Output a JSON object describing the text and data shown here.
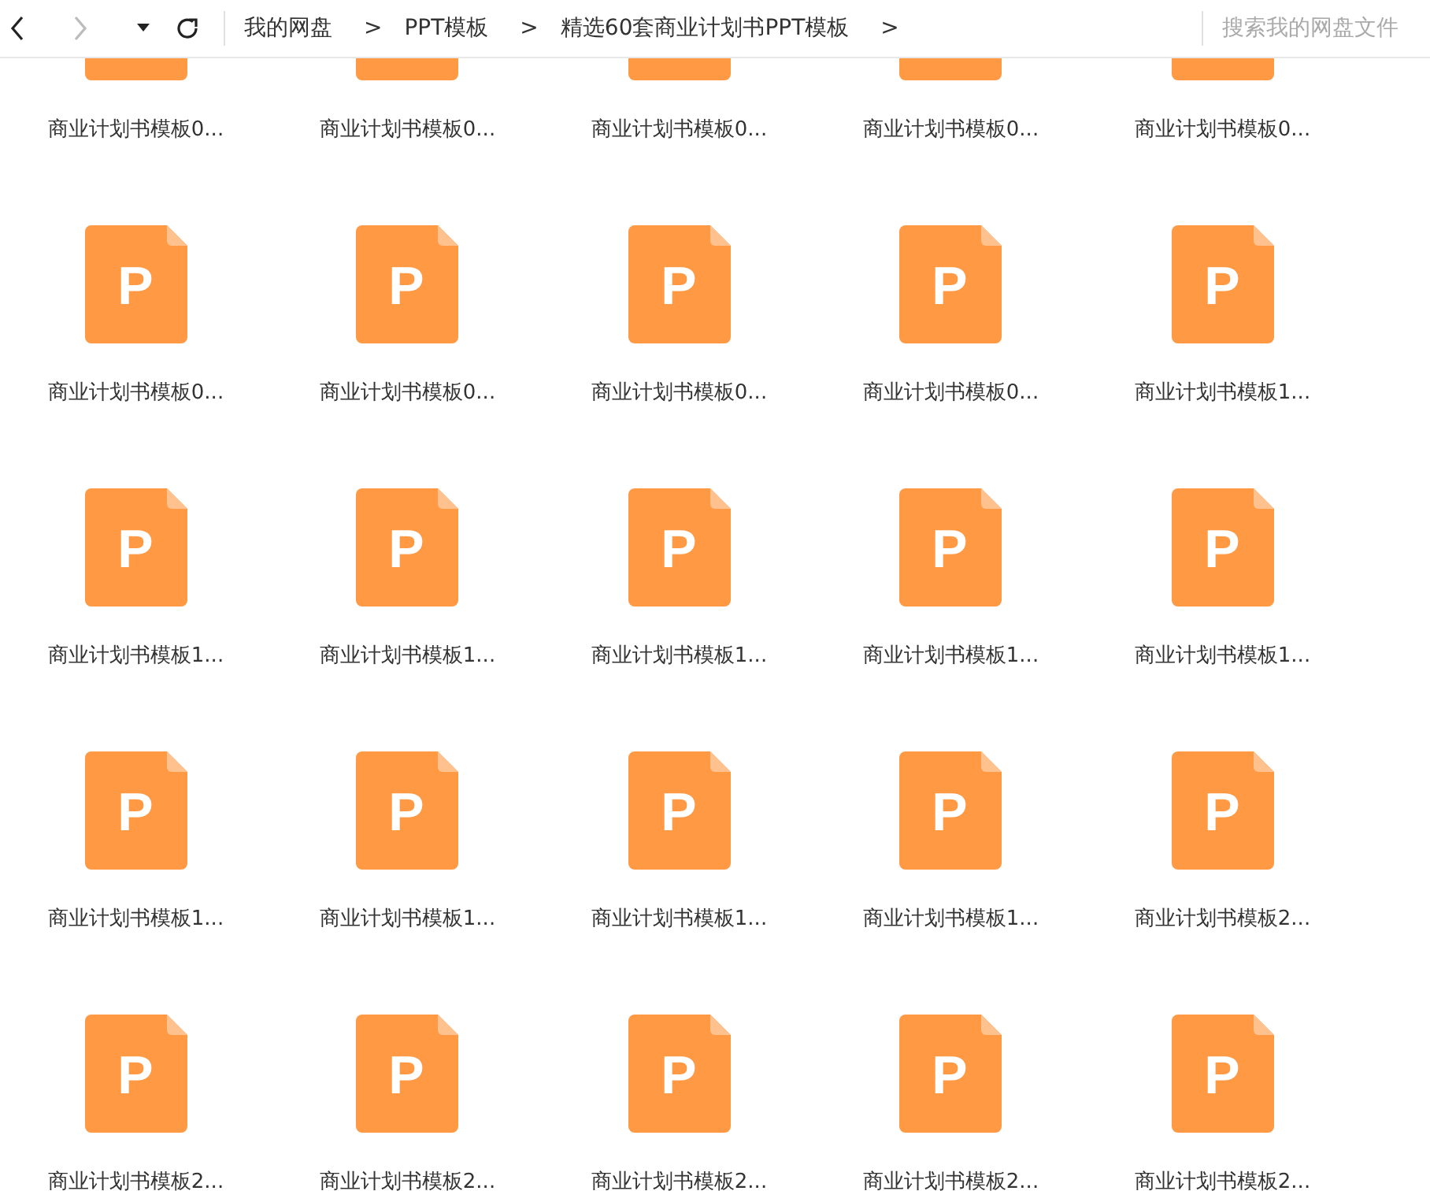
{
  "nav": {
    "back_disabled": false,
    "forward_disabled": true
  },
  "breadcrumbs": [
    {
      "label": "我的网盘",
      "separator": ">"
    },
    {
      "label": "PPT模板",
      "separator": ">"
    },
    {
      "label": "精选60套商业计划书PPT模板",
      "separator": ">"
    }
  ],
  "search": {
    "placeholder": "搜索我的网盘文件"
  },
  "files": [
    {
      "name": "商业计划书模板0..."
    },
    {
      "name": "商业计划书模板0..."
    },
    {
      "name": "商业计划书模板0..."
    },
    {
      "name": "商业计划书模板0..."
    },
    {
      "name": "商业计划书模板0..."
    },
    {
      "name": "商业计划书模板0...",
      "icon_label": "P"
    },
    {
      "name": "商业计划书模板0...",
      "icon_label": "P"
    },
    {
      "name": "商业计划书模板0...",
      "icon_label": "P"
    },
    {
      "name": "商业计划书模板0...",
      "icon_label": "P"
    },
    {
      "name": "商业计划书模板1...",
      "icon_label": "P"
    },
    {
      "name": "商业计划书模板1...",
      "icon_label": "P"
    },
    {
      "name": "商业计划书模板1...",
      "icon_label": "P"
    },
    {
      "name": "商业计划书模板1...",
      "icon_label": "P"
    },
    {
      "name": "商业计划书模板1...",
      "icon_label": "P"
    },
    {
      "name": "商业计划书模板1...",
      "icon_label": "P"
    },
    {
      "name": "商业计划书模板1...",
      "icon_label": "P"
    },
    {
      "name": "商业计划书模板1...",
      "icon_label": "P"
    },
    {
      "name": "商业计划书模板1...",
      "icon_label": "P"
    },
    {
      "name": "商业计划书模板1...",
      "icon_label": "P"
    },
    {
      "name": "商业计划书模板2...",
      "icon_label": "P"
    },
    {
      "name": "商业计划书模板2...",
      "icon_label": "P"
    },
    {
      "name": "商业计划书模板2...",
      "icon_label": "P"
    },
    {
      "name": "商业计划书模板2...",
      "icon_label": "P"
    },
    {
      "name": "商业计划书模板2...",
      "icon_label": "P"
    },
    {
      "name": "商业计划书模板2...",
      "icon_label": "P"
    }
  ]
}
